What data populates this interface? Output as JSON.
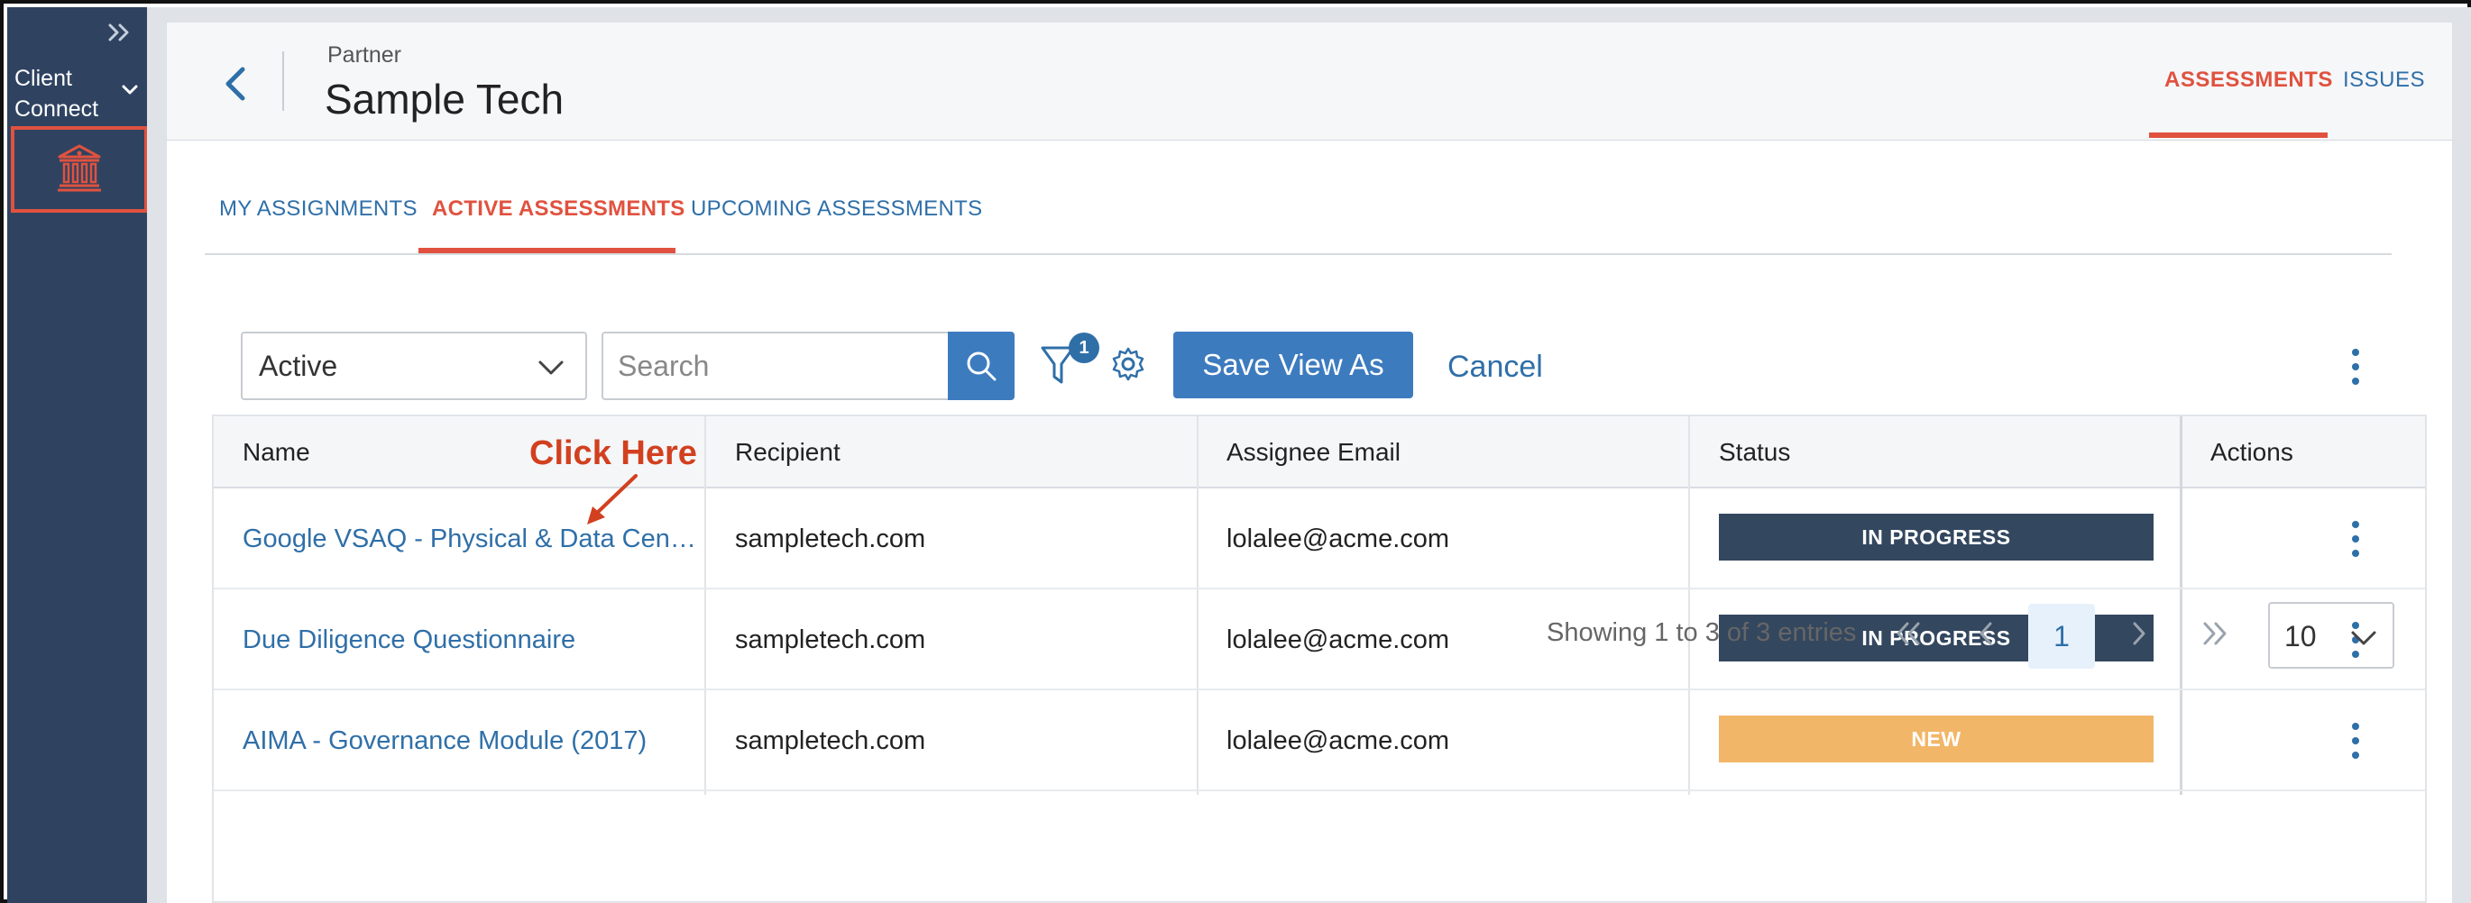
{
  "sidebar": {
    "expand_icon": "double-chevron-right-icon",
    "client_label": "Client Connect",
    "client_chevron_icon": "chevron-down-icon",
    "active_icon": "bank-icon"
  },
  "header": {
    "subtitle": "Partner",
    "title": "Sample Tech",
    "back_icon": "chevron-left-icon",
    "tabs": [
      {
        "label": "ASSESSMENTS",
        "active": true
      },
      {
        "label": "ISSUES",
        "active": false
      }
    ]
  },
  "subtabs": [
    {
      "label": "MY ASSIGNMENTS",
      "active": false
    },
    {
      "label": "ACTIVE ASSESSMENTS",
      "active": true
    },
    {
      "label": "UPCOMING ASSESSMENTS",
      "active": false
    }
  ],
  "toolbar": {
    "status_filter_value": "Active",
    "search_placeholder": "Search",
    "filter_count": "1",
    "save_view_label": "Save View As",
    "cancel_label": "Cancel"
  },
  "table": {
    "columns": [
      "Name",
      "Recipient",
      "Assignee Email",
      "Status",
      "Actions"
    ],
    "rows": [
      {
        "name": "Google VSAQ - Physical & Data Cen…",
        "recipient": "sampletech.com",
        "email": "lolalee@acme.com",
        "status": "IN PROGRESS"
      },
      {
        "name": "Due Diligence Questionnaire",
        "recipient": "sampletech.com",
        "email": "lolalee@acme.com",
        "status": "IN PROGRESS"
      },
      {
        "name": "AIMA - Governance Module (2017)",
        "recipient": "sampletech.com",
        "email": "lolalee@acme.com",
        "status": "NEW"
      }
    ]
  },
  "annotation": {
    "text": "Click Here"
  },
  "pagination": {
    "summary": "Showing 1 to 3 of 3 entries",
    "current_page": "1",
    "page_size": "10"
  },
  "colors": {
    "accent": "#e0523f",
    "link": "#2f6fa8",
    "primary_button": "#3d7bbf",
    "sidebar": "#2f4361",
    "status_in_progress": "#33475f",
    "status_new": "#f2b668"
  }
}
